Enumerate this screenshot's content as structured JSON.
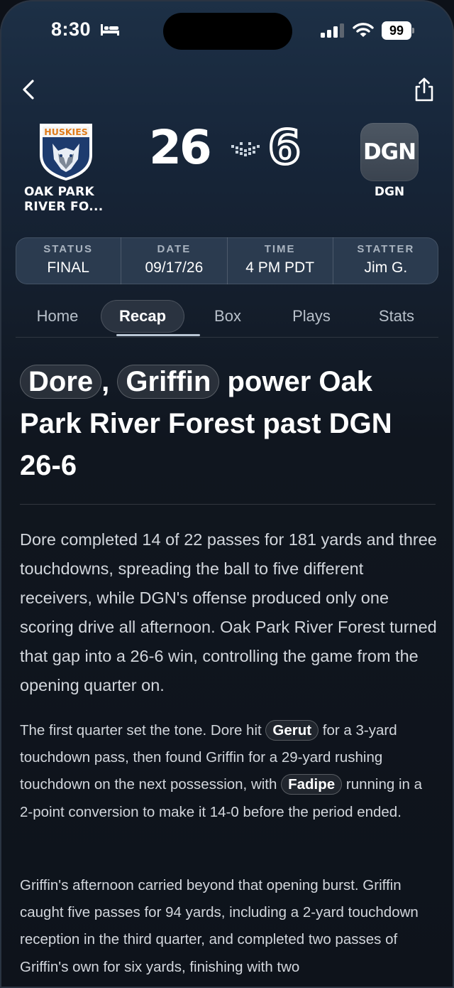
{
  "status_bar": {
    "time": "8:30",
    "battery": "99"
  },
  "game": {
    "home_team": {
      "name": "OAK PARK RIVER FO...",
      "logo_text": "HUSKIES",
      "score": "26"
    },
    "away_team": {
      "name": "DGN",
      "logo_text": "DGN",
      "score": "6"
    }
  },
  "info": [
    {
      "label": "STATUS",
      "value": "FINAL"
    },
    {
      "label": "DATE",
      "value": "09/17/26"
    },
    {
      "label": "TIME",
      "value": "4 PM PDT"
    },
    {
      "label": "STATTER",
      "value": "Jim G."
    }
  ],
  "tabs": [
    {
      "label": "Home",
      "active": false
    },
    {
      "label": "Recap",
      "active": true
    },
    {
      "label": "Box",
      "active": false
    },
    {
      "label": "Plays",
      "active": false
    },
    {
      "label": "Stats",
      "active": false
    }
  ],
  "article": {
    "headline": {
      "player1": "Dore",
      "comma": ",",
      "player2": "Griffin",
      "rest_line1": "power Oak",
      "rest_line2": "Park River Forest past DGN",
      "rest_line3": "26-6"
    },
    "paragraph1": "Dore completed 14 of 22 passes for 181 yards and three touchdowns, spreading the ball to five different receivers, while DGN's offense produced only one scoring drive all afternoon. Oak Park River Forest turned that gap into a 26-6 win, controlling the game from the opening quarter on.",
    "paragraph2": {
      "part1": "The first quarter set the tone. Dore hit",
      "player1": "Gerut",
      "part2": "for a 3-yard touchdown pass, then found Griffin for a 29-yard rushing touchdown on the next possession, with",
      "player2": "Fadipe",
      "part3": "running in a 2-point conversion to make it 14-0 before the period ended."
    },
    "paragraph3": "Griffin's afternoon carried beyond that opening burst. Griffin caught five passes for 94 yards, including a 2-yard touchdown reception in the third quarter, and completed two passes of Griffin's own for six yards, finishing with two"
  },
  "colors": {
    "background": "#10161f",
    "info_strip": "#2e3e52",
    "text_secondary": "#d2d6dc"
  }
}
